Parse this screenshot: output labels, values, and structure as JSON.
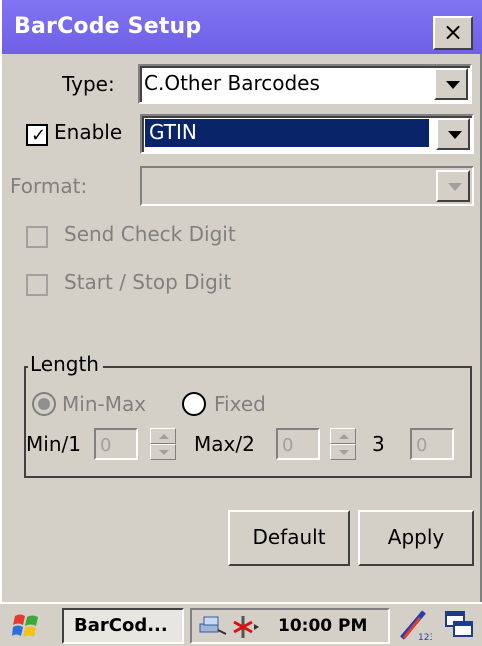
{
  "window": {
    "title": "BarCode Setup",
    "close_label": "×"
  },
  "form": {
    "type_label": "Type:",
    "type_value": "C.Other Barcodes",
    "enable_label": "Enable",
    "enable_checked": true,
    "symbology_value": "GTIN",
    "format_label": "Format:",
    "format_value": "",
    "send_check_digit_label": "Send Check Digit",
    "start_stop_digit_label": "Start / Stop Digit"
  },
  "length": {
    "legend": "Length",
    "radio_minmax_label": "Min-Max",
    "radio_fixed_label": "Fixed",
    "min_label": "Min/1",
    "min_value": "0",
    "max_label": "Max/2",
    "max_value": "0",
    "third_label": "3",
    "third_value": "0"
  },
  "buttons": {
    "default_label": "Default",
    "apply_label": "Apply"
  },
  "taskbar": {
    "task_label": "BarCod...",
    "clock": "10:00 PM"
  },
  "colors": {
    "titlebar": "#7b68ee",
    "selection": "#0a246a",
    "face": "#d4d0c8"
  }
}
